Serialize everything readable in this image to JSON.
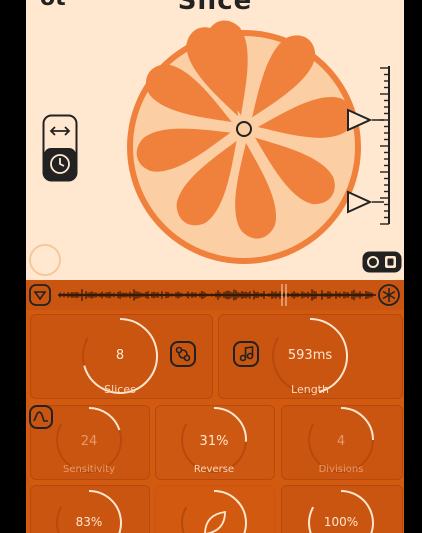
{
  "app": {
    "title": "Slice",
    "logo": "ot"
  },
  "mode_toggle": {
    "icons": [
      "arrows-horizontal-icon",
      "clock-icon"
    ],
    "selected": "clock-icon"
  },
  "bottom_toggle": {
    "icons": [
      "circle-icon",
      "square-icon"
    ]
  },
  "waveform": {
    "left_icon": "triangle-down-icon",
    "right_icon": "snowflake-icon"
  },
  "slice_count": 8,
  "colors": {
    "cream": "#FFE8CF",
    "orange": "#F0813D",
    "deep_orange": "#D25A10",
    "panel": "#C95510",
    "light": "#FFD9B8"
  },
  "controls": {
    "slices": {
      "value": "8",
      "label": "Slices",
      "icon": "shuffle-icon",
      "level": 0.85
    },
    "length": {
      "value": "593ms",
      "label": "Length",
      "icon": "music-note-icon",
      "level": 0.55
    },
    "sensitivity": {
      "value": "24",
      "label": "Sensitivity",
      "icon": "envelope-icon",
      "level": 0.24
    },
    "reverse": {
      "value": "31%",
      "label": "Reverse",
      "level": 0.31
    },
    "divisions": {
      "value": "4",
      "label": "Divisions",
      "level": 0.3
    },
    "row4_left": {
      "value": "83%",
      "level": 0.83
    },
    "row4_mid": {
      "icon": "leaf-icon",
      "level": 0.6
    },
    "row4_right": {
      "value": "100%",
      "level": 1.0
    }
  }
}
